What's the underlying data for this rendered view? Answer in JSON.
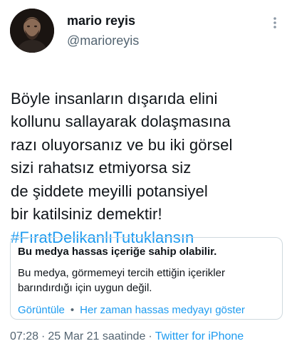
{
  "user": {
    "display_name": "mario reyis",
    "handle": "@marioreyis",
    "avatar_icon": "profile-photo"
  },
  "more_icon": "more-vertical-icon",
  "tweet": {
    "text": "Böyle insanların dışarıda elini\nkollunu sallayarak dolaşmasına\nrazı oluyorsanız ve bu iki görsel\nsizi rahatsız etmiyorsa siz\nde şiddete meyilli potansiyel\nbir katilsiniz demektir!",
    "hashtag": "#FıratDelikanlıTutuklansın"
  },
  "sensitive_notice": {
    "title": "Bu medya hassas içeriğe sahip olabilir.",
    "description": "Bu medya, görmemeyi tercih ettiğin içerikler barındırdığı için uygun değil.",
    "view_label": "Görüntüle",
    "separator": "•",
    "always_show_label": "Her zaman hassas medyayı göster"
  },
  "meta": {
    "time": "07:28",
    "date": "25 Mar 21 saatinde",
    "separator": "·",
    "source": "Twitter for iPhone"
  },
  "colors": {
    "accent": "#1d9bf0",
    "muted": "#536471",
    "border": "#cfd9de"
  }
}
